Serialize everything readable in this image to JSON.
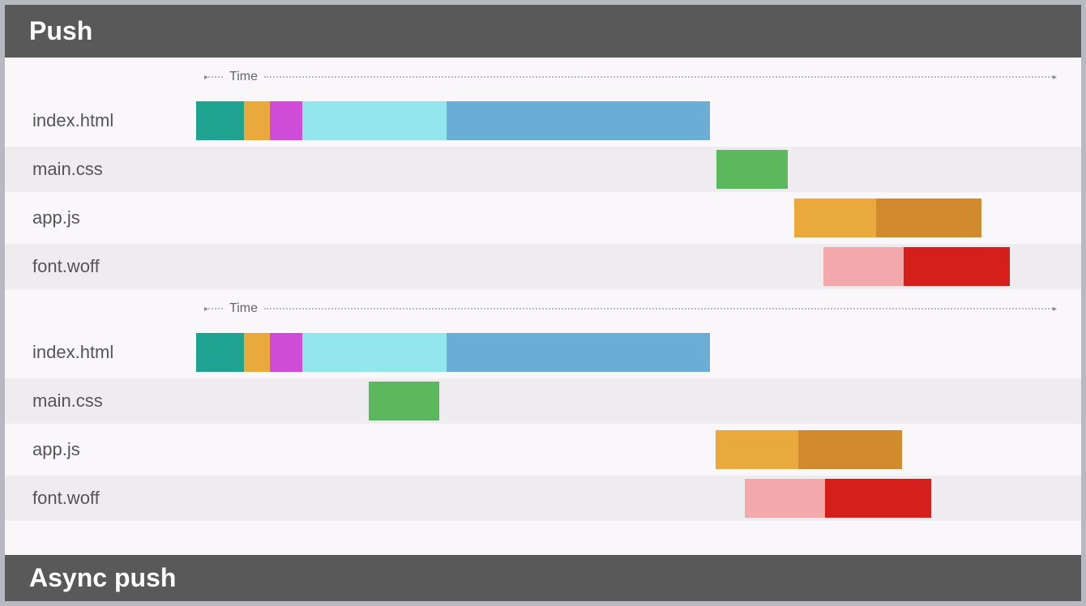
{
  "header1": "Push",
  "header2": "Async push",
  "time_label": "Time",
  "chart_data": [
    {
      "title": "Push",
      "type": "gantt",
      "xlabel": "Time",
      "ylabel": "",
      "xlim": [
        0,
        100
      ],
      "rows": [
        {
          "label": "index.html",
          "segments": [
            {
              "start": 0,
              "end": 5.5,
              "color": "#1fa28f"
            },
            {
              "start": 5.5,
              "end": 8.5,
              "color": "#e9a93c"
            },
            {
              "start": 8.5,
              "end": 12.3,
              "color": "#d04cd8"
            },
            {
              "start": 12.3,
              "end": 29,
              "color": "#93e6ec"
            },
            {
              "start": 29,
              "end": 59.5,
              "color": "#6aaed6"
            }
          ]
        },
        {
          "label": "main.css",
          "segments": [
            {
              "start": 60.3,
              "end": 68.5,
              "color": "#5bb85c"
            }
          ]
        },
        {
          "label": "app.js",
          "segments": [
            {
              "start": 69.3,
              "end": 78.8,
              "color": "#e9a93c"
            },
            {
              "start": 78.8,
              "end": 91,
              "color": "#d18a2e"
            }
          ]
        },
        {
          "label": "font.woff",
          "segments": [
            {
              "start": 72.7,
              "end": 82,
              "color": "#f3a8ab"
            },
            {
              "start": 82,
              "end": 94.3,
              "color": "#d41f1a"
            }
          ]
        }
      ]
    },
    {
      "title": "Push (second timeline)",
      "type": "gantt",
      "xlabel": "Time",
      "ylabel": "",
      "xlim": [
        0,
        100
      ],
      "rows": [
        {
          "label": "index.html",
          "segments": [
            {
              "start": 0,
              "end": 5.5,
              "color": "#1fa28f"
            },
            {
              "start": 5.5,
              "end": 8.5,
              "color": "#e9a93c"
            },
            {
              "start": 8.5,
              "end": 12.3,
              "color": "#d04cd8"
            },
            {
              "start": 12.3,
              "end": 29,
              "color": "#93e6ec"
            },
            {
              "start": 29,
              "end": 59.5,
              "color": "#6aaed6"
            }
          ]
        },
        {
          "label": "main.css",
          "segments": [
            {
              "start": 20,
              "end": 28.2,
              "color": "#5bb85c"
            }
          ]
        },
        {
          "label": "app.js",
          "segments": [
            {
              "start": 60.2,
              "end": 69.8,
              "color": "#e9a93c"
            },
            {
              "start": 69.8,
              "end": 81.8,
              "color": "#d18a2e"
            }
          ]
        },
        {
          "label": "font.woff",
          "segments": [
            {
              "start": 63.6,
              "end": 72.9,
              "color": "#f3a8ab"
            },
            {
              "start": 72.9,
              "end": 85.2,
              "color": "#d41f1a"
            }
          ]
        }
      ]
    }
  ]
}
